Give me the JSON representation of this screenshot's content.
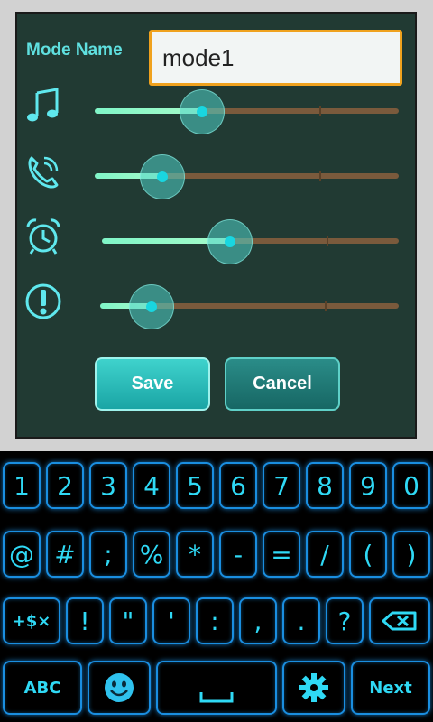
{
  "dialog": {
    "mode_label": "Mode Name",
    "mode_value": "mode1",
    "sliders": [
      {
        "icon": "music-note-icon",
        "value": 0.35
      },
      {
        "icon": "phone-ring-icon",
        "value": 0.22
      },
      {
        "icon": "alarm-clock-icon",
        "value": 0.43
      },
      {
        "icon": "alert-icon",
        "value": 0.17
      }
    ],
    "save_label": "Save",
    "cancel_label": "Cancel"
  },
  "keyboard": {
    "row1": [
      "1",
      "2",
      "3",
      "4",
      "5",
      "6",
      "7",
      "8",
      "9",
      "0"
    ],
    "row2": [
      "@",
      "#",
      ";",
      "%",
      "*",
      "-",
      "=",
      "/",
      "(",
      ")"
    ],
    "row3": [
      "+$×",
      "!",
      "\"",
      "'",
      ":",
      ",",
      ".",
      "?"
    ],
    "row3_backspace_icon": "backspace-icon",
    "abc_label": "ABC",
    "emoji_icon": "smiley-icon",
    "space_icon": "space-bar-icon",
    "settings_icon": "gear-icon",
    "next_label": "Next"
  },
  "colors": {
    "accent": "#2fd9f5",
    "dialog_bg": "#213a33",
    "input_border": "#f0a21e"
  }
}
